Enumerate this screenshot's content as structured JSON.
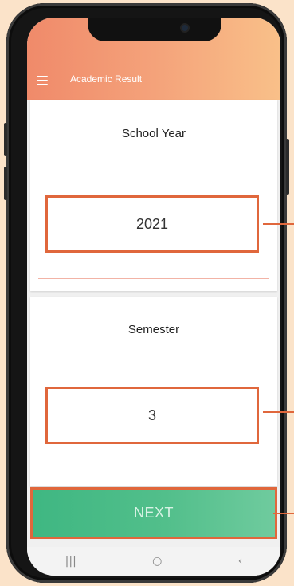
{
  "app": {
    "title": "Academic Result"
  },
  "header": {
    "menu_icon": "hamburger-menu-icon"
  },
  "school_year": {
    "label": "School Year",
    "value": "2021"
  },
  "semester": {
    "label": "Semester",
    "value": "3"
  },
  "actions": {
    "next_label": "NEXT"
  },
  "nav": {
    "recents": "|||",
    "home": "○",
    "back": "‹"
  },
  "colors": {
    "header_gradient_start": "#f08a6a",
    "header_gradient_end": "#f9c089",
    "highlight_border": "#e0673c",
    "next_button": "#4cbb88",
    "page_background": "#fbe3c9"
  }
}
